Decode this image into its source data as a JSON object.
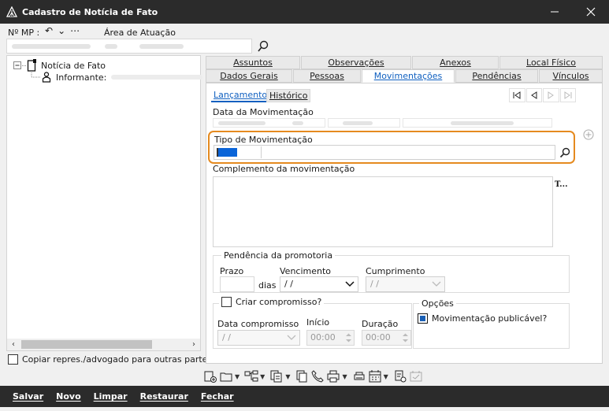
{
  "window": {
    "title": "Cadastro de Notícia de Fato"
  },
  "header": {
    "mp_label": "Nº MP :",
    "area_label": "Área de Atuação"
  },
  "tree": {
    "root_label": "Notícia de Fato",
    "child_label": "Informante:"
  },
  "copy_checkbox_label": "Copiar repres./advogado para outras partes",
  "tabs_top": [
    "Assuntos",
    "Observações",
    "Anexos",
    "Local Físico"
  ],
  "tabs_bottom": [
    "Dados Gerais",
    "Pessoas",
    "Movimentações",
    "Pendências",
    "Vínculos"
  ],
  "active_tab": "Movimentações",
  "subtabs": [
    "Lançamento",
    "Histórico"
  ],
  "form": {
    "data_movimentacao_label": "Data da Movimentação",
    "tipo_movimentacao_label": "Tipo de Movimentação",
    "complemento_label": "Complemento da movimentação",
    "font_tool": "T...",
    "pendencia_group": "Pendência da promotoria",
    "prazo_label": "Prazo",
    "dias_label": "dias",
    "vencimento_label": "Vencimento",
    "vencimento_value": " / /",
    "cumprimento_label": "Cumprimento",
    "cumprimento_value": " / /",
    "criar_compromisso_label": "Criar compromisso?",
    "data_compromisso_label": "Data compromisso",
    "data_compromisso_value": " / /",
    "inicio_label": "Início",
    "inicio_value": "00:00",
    "duracao_label": "Duração",
    "duracao_value": "00:00",
    "opcoes_group": "Opções",
    "publicavel_label": "Movimentação publicável?"
  },
  "footer": [
    "Salvar",
    "Novo",
    "Limpar",
    "Restaurar",
    "Fechar"
  ],
  "colors": {
    "accent": "#1060c0",
    "highlight": "#e58a1f",
    "titlebar": "#2b2b2b"
  }
}
